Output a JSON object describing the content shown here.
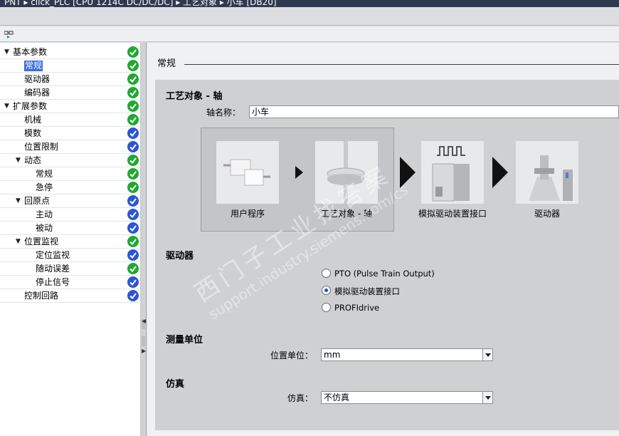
{
  "titlebar": {
    "text": "PNT ▸ click_PLC [CPU 1214C DC/DC/DC] ▸ 工艺对象 ▸ 小车 [DB20]"
  },
  "tree": {
    "items": [
      {
        "label": "基本参数",
        "expanded": true,
        "status": "ok"
      },
      {
        "label": "常规",
        "selected": true,
        "status": "ok"
      },
      {
        "label": "驱动器",
        "status": "ok"
      },
      {
        "label": "编码器",
        "status": "ok"
      },
      {
        "label": "扩展参数",
        "expanded": true,
        "status": "ok"
      },
      {
        "label": "机械",
        "status": "ok"
      },
      {
        "label": "模数",
        "status": "info"
      },
      {
        "label": "位置限制",
        "status": "info"
      },
      {
        "label": "动态",
        "expanded": true,
        "status": "ok"
      },
      {
        "label": "常规",
        "status": "ok"
      },
      {
        "label": "急停",
        "status": "ok"
      },
      {
        "label": "回原点",
        "expanded": true,
        "status": "info"
      },
      {
        "label": "主动",
        "status": "info"
      },
      {
        "label": "被动",
        "status": "info"
      },
      {
        "label": "位置监视",
        "expanded": true,
        "status": "ok"
      },
      {
        "label": "定位监视",
        "status": "info"
      },
      {
        "label": "随动误差",
        "status": "ok"
      },
      {
        "label": "停止信号",
        "status": "info"
      },
      {
        "label": "控制回路",
        "status": "info"
      }
    ]
  },
  "main": {
    "section_title": "常规",
    "tech_object": {
      "heading": "工艺对象 - 轴",
      "axis_name_label": "轴名称：",
      "axis_name_value": "小车"
    },
    "diagram": {
      "labels": [
        "用户程序",
        "工艺对象 - 轴",
        "模拟驱动装置接口",
        "驱动器"
      ]
    },
    "drive": {
      "heading": "驱动器",
      "options": [
        "PTO (Pulse Train Output)",
        "模拟驱动装置接口",
        "PROFIdrive"
      ],
      "selected_index": 1
    },
    "units": {
      "heading": "测量单位",
      "label": "位置单位：",
      "value": "mm"
    },
    "simulation": {
      "heading": "仿真",
      "label": "仿真：",
      "value": "不仿真"
    }
  },
  "watermark": {
    "line1": "西门子工业找答案",
    "line2": "support.industry.siemens.com/cs"
  },
  "colors": {
    "ok": "#21a832",
    "info": "#2a55d6",
    "selected": "#3b6fd6"
  }
}
